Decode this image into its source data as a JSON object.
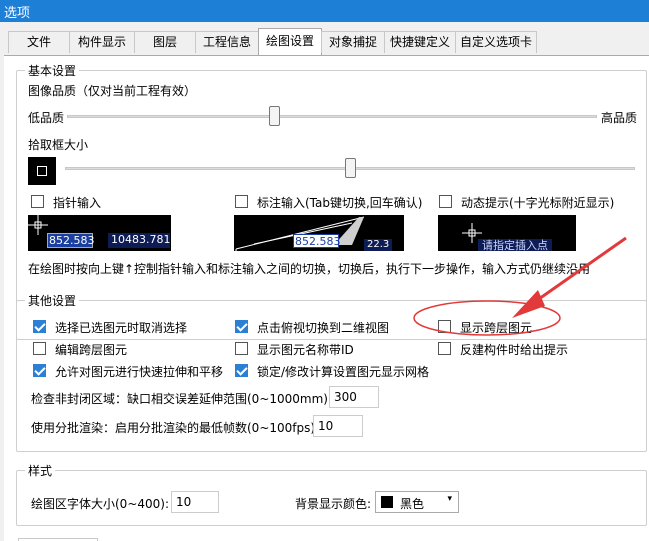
{
  "window": {
    "title": "选项"
  },
  "tabs": [
    "文件",
    "构件显示",
    "图层",
    "工程信息",
    "绘图设置",
    "对象捕捉",
    "快捷键定义",
    "自定义选项卡"
  ],
  "active_tab": "绘图设置",
  "basic": {
    "title": "基本设置",
    "quality_label": "图像品质（仅对当前工程有效）",
    "quality_low": "低品质",
    "quality_high": "高品质",
    "quality_value": 0.39,
    "pickbox_label": "拾取框大小",
    "pickbox_value": 0.5,
    "pointer_input": {
      "label": "指针输入",
      "checked": false
    },
    "dim_input": {
      "label": "标注输入(Tab键切换,回车确认)",
      "checked": false
    },
    "dynamic_hint": {
      "label": "动态提示(十字光标附近显示)",
      "checked": false
    },
    "preview1_a": "852.583",
    "preview1_b": "10483.781",
    "preview2_a": "852.583",
    "preview2_b": "22.3",
    "preview3_text": "请指定插入点",
    "hint": "在绘图时按向上键↑控制指针输入和标注输入之间的切换，切换后，执行下一步操作，输入方式仍继续沿用"
  },
  "other": {
    "title": "其他设置",
    "items": [
      {
        "label": "选择已选图元时取消选择",
        "checked": true
      },
      {
        "label": "点击俯视切换到二维视图",
        "checked": true
      },
      {
        "label": "显示跨层图元",
        "checked": false
      },
      {
        "label": "编辑跨层图元",
        "checked": false
      },
      {
        "label": "显示图元名称带ID",
        "checked": false
      },
      {
        "label": "反建构件时给出提示",
        "checked": false
      },
      {
        "label": "允许对图元进行快速拉伸和平移",
        "checked": true
      },
      {
        "label": "锁定/修改计算设置图元显示网格",
        "checked": true
      }
    ],
    "gap_label": "检查非封闭区域：缺口相交误差延伸范围(0~1000mm):",
    "gap_value": "300",
    "batch_label": "使用分批渲染：启用分批渲染的最低帧数(0~100fps):",
    "batch_value": "10"
  },
  "style": {
    "title": "样式",
    "font_label": "绘图区字体大小(0~400):",
    "font_value": "10",
    "bg_label": "背景显示颜色:",
    "bg_value": "黑色",
    "bg_swatch": "#000000"
  },
  "colors": {
    "titlebar": "#1e7fd7",
    "accent": "#2d7fd3",
    "annotation": "#e23a3a"
  }
}
